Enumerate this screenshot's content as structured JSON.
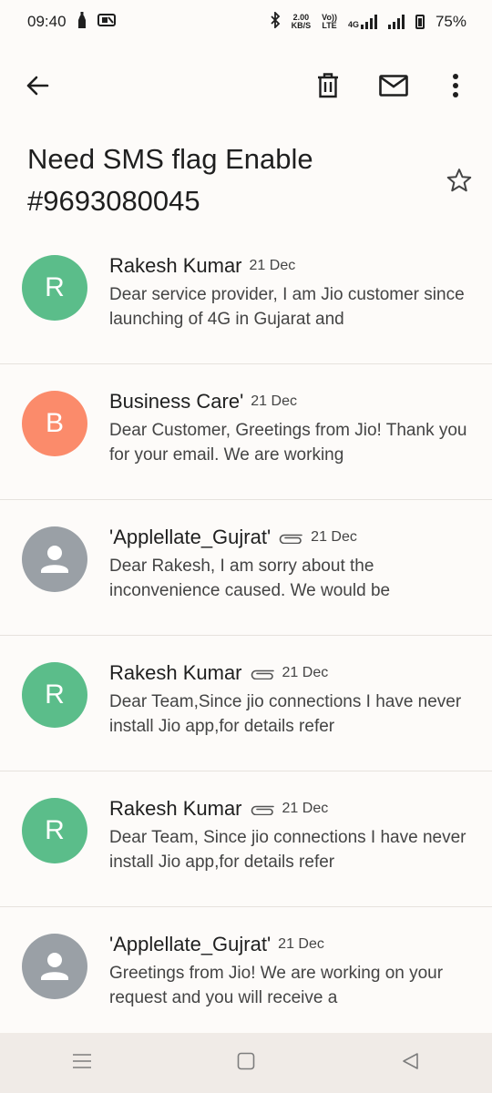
{
  "status": {
    "time": "09:40",
    "speed_top": "2.00",
    "speed_bottom": "KB/S",
    "volte_top": "Vo))",
    "volte_bottom": "LTE",
    "network": "4G",
    "battery": "75%"
  },
  "icons": {
    "back": "arrow-left",
    "delete": "trash",
    "mark_unread": "mail",
    "more": "three-dots-vertical",
    "star": "star-outline",
    "attachment": "paperclip"
  },
  "thread": {
    "subject": "Need SMS flag Enable #9693080045"
  },
  "messages": [
    {
      "sender": "Rakesh Kumar",
      "date": "21 Dec",
      "avatar_letter": "R",
      "avatar_color": "#5bbd8a",
      "attachment": false,
      "snippet": "Dear service provider, I am Jio customer since launching of 4G in Gujarat and"
    },
    {
      "sender": "Business Care'",
      "date": "21 Dec",
      "avatar_letter": "B",
      "avatar_color": "#fb8b6b",
      "attachment": false,
      "snippet": "Dear Customer, Greetings from Jio! Thank you for your email. We are working"
    },
    {
      "sender": "'Applellate_Gujrat'",
      "date": "21 Dec",
      "avatar_letter": "",
      "avatar_color": "#9aa0a6",
      "attachment": true,
      "snippet": "Dear Rakesh, I am sorry about the inconvenience caused. We would be"
    },
    {
      "sender": "Rakesh Kumar",
      "date": "21 Dec",
      "avatar_letter": "R",
      "avatar_color": "#5bbd8a",
      "attachment": true,
      "snippet": "Dear Team,Since jio connections I have never install Jio app,for details refer"
    },
    {
      "sender": "Rakesh Kumar",
      "date": "21 Dec",
      "avatar_letter": "R",
      "avatar_color": "#5bbd8a",
      "attachment": true,
      "snippet": "Dear Team, Since jio connections I have never install Jio app,for details refer"
    },
    {
      "sender": "'Applellate_Gujrat'",
      "date": "21 Dec",
      "avatar_letter": "",
      "avatar_color": "#9aa0a6",
      "attachment": false,
      "snippet": "Greetings from Jio! We are working on your request and you will receive a"
    }
  ],
  "navbar": {
    "recents": "menu-lines",
    "home": "square",
    "back": "triangle-left"
  }
}
